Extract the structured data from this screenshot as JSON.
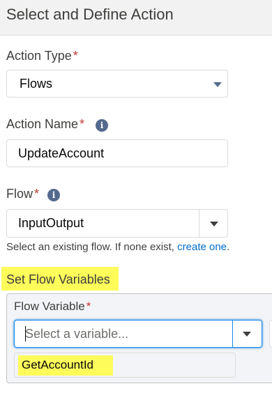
{
  "header": {
    "title": "Select and Define Action"
  },
  "action_type": {
    "label": "Action Type",
    "required_mark": "*",
    "value": "Flows"
  },
  "action_name": {
    "label": "Action Name",
    "required_mark": "*",
    "info_icon": "i",
    "value": "UpdateAccount"
  },
  "flow": {
    "label": "Flow",
    "required_mark": "*",
    "info_icon": "i",
    "value": "InputOutput",
    "helper_text": "Select an existing flow. If none exist, ",
    "helper_link": "create one",
    "helper_end": "."
  },
  "set_flow_variables": {
    "label": "Set Flow Variables"
  },
  "flow_variable": {
    "label": "Flow Variable",
    "required_mark": "*",
    "placeholder": "Select a variable...",
    "value": "GetAccountId"
  },
  "colors": {
    "header_bg": "#f3f2f2",
    "required": "#c23934",
    "link": "#006dcc",
    "highlight": "#fdfc5a",
    "focus_border": "#1589ee"
  },
  "icons": [
    "info-icon",
    "chevron-down-icon"
  ]
}
